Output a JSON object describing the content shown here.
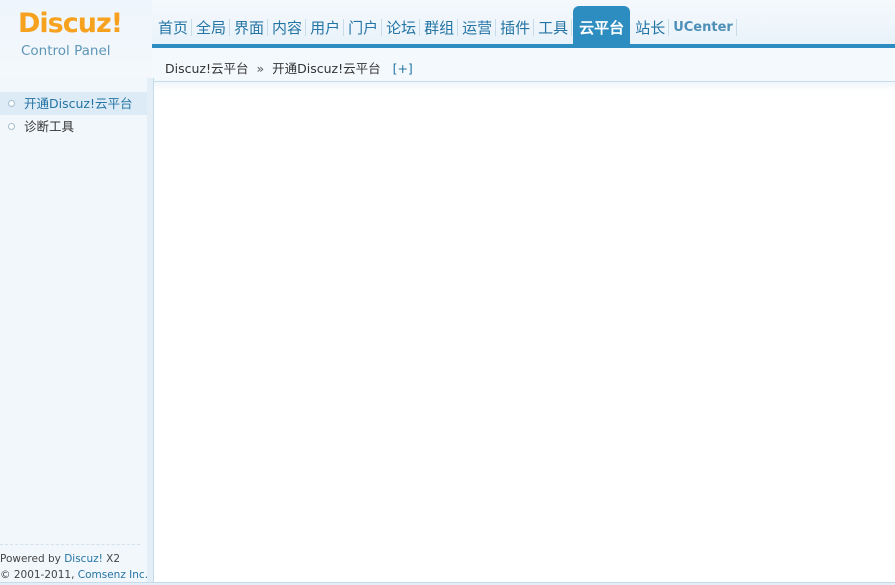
{
  "logo": {
    "main": "Discuz",
    "bang": "!",
    "sub": "Control Panel"
  },
  "nav": {
    "items": [
      {
        "label": "首页"
      },
      {
        "label": "全局"
      },
      {
        "label": "界面"
      },
      {
        "label": "内容"
      },
      {
        "label": "用户"
      },
      {
        "label": "门户"
      },
      {
        "label": "论坛"
      },
      {
        "label": "群组"
      },
      {
        "label": "运营"
      },
      {
        "label": "插件"
      },
      {
        "label": "工具"
      },
      {
        "label": "云平台",
        "active": true
      },
      {
        "label": "站长"
      },
      {
        "label": "UCenter"
      }
    ]
  },
  "breadcrumb": {
    "root": "Discuz!云平台",
    "separator": "»",
    "current": "开通Discuz!云平台",
    "expand_label": "[+]"
  },
  "sidebar": {
    "items": [
      {
        "label": "开通Discuz!云平台",
        "active": true
      },
      {
        "label": "诊断工具"
      }
    ]
  },
  "footer": {
    "powered_prefix": "Powered by ",
    "powered_link": "Discuz!",
    "powered_version": " X2",
    "copyright_prefix": "© 2001-2011, ",
    "copyright_link": "Comsenz Inc."
  },
  "colors": {
    "accent": "#2d8cc0",
    "logo_orange": "#f7a21f",
    "link": "#2474a4"
  }
}
